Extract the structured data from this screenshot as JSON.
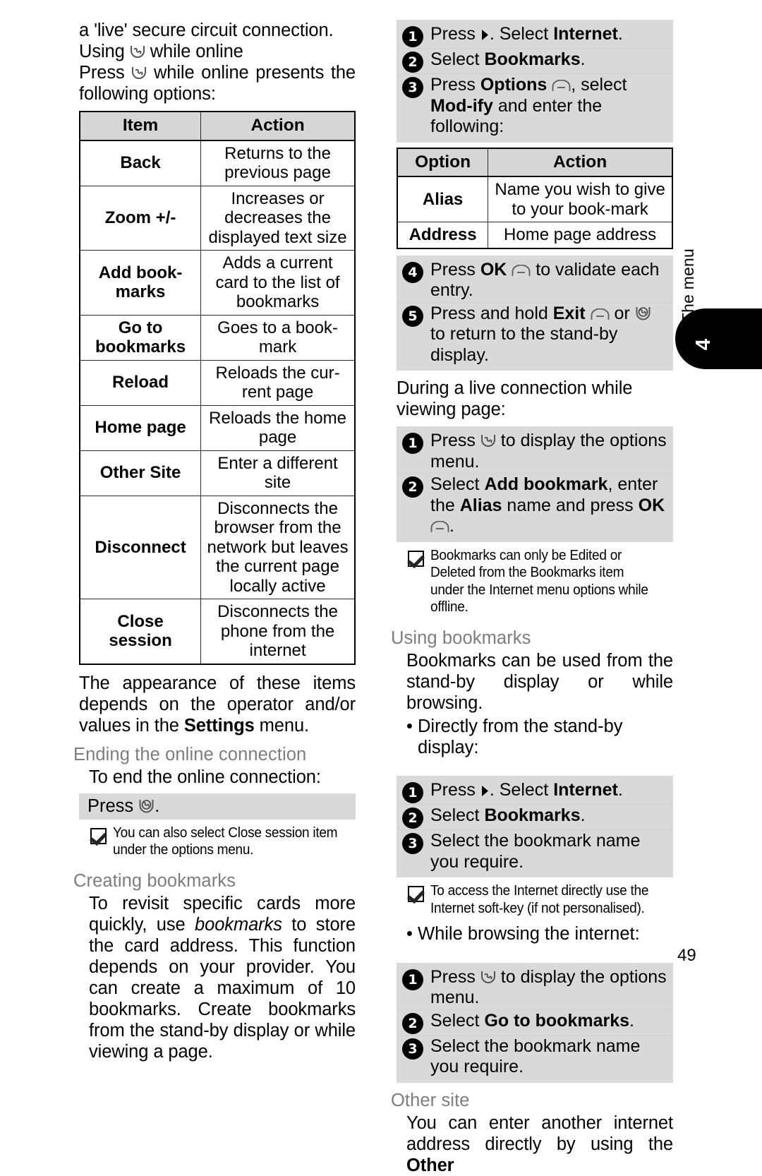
{
  "page": {
    "number": "49",
    "side_tab_label": "The menu",
    "side_tab_number": "4"
  },
  "left_column": {
    "intro": {
      "line1": "a 'live' secure circuit connection.",
      "line2_pre": "Using",
      "line2_post": "while online",
      "line3_pre": "Press",
      "line3_post": "while online presents the following options:"
    },
    "options_table": {
      "headers": [
        "Item",
        "Action"
      ],
      "rows": [
        {
          "item": "Back",
          "action": "Returns to the previous page"
        },
        {
          "item": "Zoom +/-",
          "action": "Increases or decreases the displayed text size"
        },
        {
          "item": "Add book-marks",
          "action": "Adds a current card to the list of bookmarks"
        },
        {
          "item": "Go to bookmarks",
          "action": "Goes to a book-mark"
        },
        {
          "item": "Reload",
          "action": "Reloads the cur-rent page"
        },
        {
          "item": "Home page",
          "action": "Reloads the home page"
        },
        {
          "item": "Other Site",
          "action": "Enter a different site"
        },
        {
          "item": "Disconnect",
          "action": "Disconnects the browser from the network but leaves the current page locally active"
        },
        {
          "item": "Close session",
          "action": "Disconnects the phone from the internet"
        }
      ]
    },
    "after_table_para_pre": "The appearance of these items depends on the operator and/or values in the ",
    "after_table_bold": "Settings",
    "after_table_para_post": " menu.",
    "ending_heading": "Ending the online connection",
    "ending_lead": "To end the online connection:",
    "ending_press": "Press",
    "ending_press_tail": ".",
    "ending_note": "You can also select Close session item under the options menu.",
    "creating_heading": "Creating bookmarks",
    "creating_para_1": "To revisit specific cards more quickly, use ",
    "creating_para_italic": "bookmarks",
    "creating_para_2": " to store the card address. This function depends on your provider. You can create a maximum of 10 bookmarks. Create bookmarks from the stand-by display or while viewing a page."
  },
  "right_column": {
    "modify_steps": [
      {
        "num": "1",
        "pre": "Press",
        "mid": ". Select ",
        "bold": "Internet",
        "post": "."
      },
      {
        "num": "2",
        "pre": "Select ",
        "bold": "Bookmarks",
        "post": "."
      },
      {
        "num": "3",
        "pre": "Press ",
        "bold": "Options",
        "mid": ", select ",
        "bold2": "Mod-ify",
        "post": " and enter the following:"
      }
    ],
    "modify_table": {
      "headers": [
        "Option",
        "Action"
      ],
      "rows": [
        {
          "option": "Alias",
          "action": "Name you wish to give to your book-mark"
        },
        {
          "option": "Address",
          "action": "Home page address"
        }
      ]
    },
    "validate_steps": [
      {
        "num": "4",
        "pre": "Press ",
        "bold": "OK",
        "post": " to validate each entry."
      },
      {
        "num": "5",
        "pre": "Press and hold ",
        "bold": "Exit",
        "mid": " or ",
        "post": " to return to the stand-by display."
      }
    ],
    "live_lead": "During a live connection while viewing page:",
    "live_steps": [
      {
        "num": "1",
        "pre": "Press ",
        "post": " to display the options menu."
      },
      {
        "num": "2",
        "pre": "Select ",
        "bold": "Add bookmark",
        "mid": ", enter the ",
        "bold2": "Alias",
        "post": " name and press ",
        "bold3": "OK",
        "tail": "."
      }
    ],
    "note_1": "Bookmarks can only be Edited or Deleted from the Bookmarks item under the Internet menu options while offline.",
    "using_heading": "Using bookmarks",
    "using_para": "Bookmarks can be used from the stand-by display or while browsing.",
    "bullet_standby": "Directly from the stand-by display:",
    "standby_steps": [
      {
        "num": "1",
        "pre": "Press",
        "mid": ". Select ",
        "bold": "Internet",
        "post": "."
      },
      {
        "num": "2",
        "pre": "Select ",
        "bold": "Bookmarks",
        "post": "."
      },
      {
        "num": "3",
        "pre": "Select the bookmark name you require.",
        "bold": "",
        "post": ""
      }
    ],
    "note_2": "To access the Internet directly use the Internet soft-key (if not personalised).",
    "bullet_browsing": "While browsing the internet:",
    "browsing_steps": [
      {
        "num": "1",
        "pre": "Press ",
        "post": " to display the options menu."
      },
      {
        "num": "2",
        "pre": "Select ",
        "bold": "Go to bookmarks",
        "post": "."
      },
      {
        "num": "3",
        "pre": "Select the bookmark name you require.",
        "bold": "",
        "post": ""
      }
    ],
    "other_heading": "Other site",
    "other_para_1": "You can enter another internet address directly by using the ",
    "other_para_bold": "Other"
  },
  "icons": {
    "call_key": "call-key-icon",
    "hangup_key": "hangup-key-icon",
    "soft_key": "soft-key-icon",
    "nav_right": "nav-right-icon",
    "check": "check-icon"
  }
}
